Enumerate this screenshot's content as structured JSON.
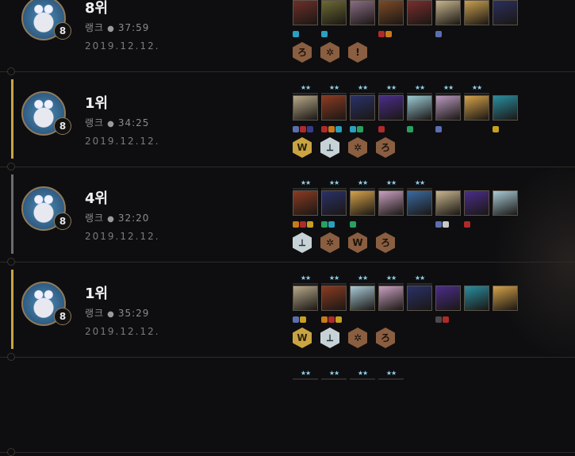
{
  "matches": [
    {
      "placement": "8위",
      "mode": "랭크",
      "duration": "37:59",
      "date": "2019.12.12.",
      "level": "8",
      "accent": "",
      "champions": [
        {
          "stars": "",
          "color": "#6e2f2a",
          "items": [
            "#2aa0c0"
          ]
        },
        {
          "stars": "",
          "color": "#6d6a34",
          "items": [
            "#2aa0c0"
          ]
        },
        {
          "stars": "",
          "color": "#8b6d86",
          "items": []
        },
        {
          "stars": "",
          "color": "#7e4a26",
          "items": [
            "#b02a2a",
            "#c87a1a"
          ]
        },
        {
          "stars": "",
          "color": "#7a2e2e",
          "items": []
        },
        {
          "stars": "",
          "color": "#c7b58e",
          "items": [
            "#5b6fb0"
          ]
        },
        {
          "stars": "",
          "color": "#c9a04e",
          "items": []
        },
        {
          "stars": "",
          "color": "#2b2f5c",
          "items": []
        }
      ],
      "traits": [
        {
          "tier": "bronze",
          "glyph": "ろ",
          "name": "trait-hexagon-icon"
        },
        {
          "tier": "bronze",
          "glyph": "✲",
          "name": "trait-hexagon-icon"
        },
        {
          "tier": "bronze",
          "glyph": "!",
          "name": "trait-hexagon-icon"
        }
      ]
    },
    {
      "placement": "1위",
      "mode": "랭크",
      "duration": "34:25",
      "date": "2019.12.12.",
      "level": "8",
      "accent": "#c9a441",
      "champions": [
        {
          "stars": "★★",
          "color": "#b7a98a",
          "items": [
            "#5b6fb0",
            "#b02a2a",
            "#3a3a8a"
          ]
        },
        {
          "stars": "★★",
          "color": "#8a3b22",
          "items": [
            "#b02a2a",
            "#c87a1a",
            "#2aa0c0"
          ]
        },
        {
          "stars": "★★",
          "color": "#2a3168",
          "items": [
            "#2aa0c0",
            "#28a060"
          ]
        },
        {
          "stars": "★★",
          "color": "#4b2d8a",
          "items": [
            "#b02a2a"
          ]
        },
        {
          "stars": "★★",
          "color": "#9cc9d4",
          "items": [
            "#28a060"
          ]
        },
        {
          "stars": "★★",
          "color": "#b99abf",
          "items": [
            "#5b6fb0"
          ]
        },
        {
          "stars": "★★",
          "color": "#d4a24a",
          "items": []
        },
        {
          "stars": "",
          "color": "#2a8ea0",
          "items": [
            "#c8a020"
          ]
        }
      ],
      "traits": [
        {
          "tier": "gold",
          "glyph": "W",
          "name": "trait-hexagon-icon"
        },
        {
          "tier": "silver",
          "glyph": "⟂",
          "name": "trait-hexagon-icon"
        },
        {
          "tier": "bronze",
          "glyph": "✲",
          "name": "trait-hexagon-icon"
        },
        {
          "tier": "bronze",
          "glyph": "ろ",
          "name": "trait-hexagon-icon"
        }
      ]
    },
    {
      "placement": "4위",
      "mode": "랭크",
      "duration": "32:20",
      "date": "2019.12.12.",
      "level": "8",
      "accent": "#6b6b6b",
      "champions": [
        {
          "stars": "★★",
          "color": "#8a3b22",
          "items": [
            "#c87a1a",
            "#b02a2a",
            "#c8a020"
          ]
        },
        {
          "stars": "★★",
          "color": "#2a3168",
          "items": [
            "#28a060",
            "#2aa0c0"
          ]
        },
        {
          "stars": "★★",
          "color": "#d4a24a",
          "items": [
            "#28a060"
          ]
        },
        {
          "stars": "★★",
          "color": "#c9a0c0",
          "items": []
        },
        {
          "stars": "★★",
          "color": "#3a6aa0",
          "items": []
        },
        {
          "stars": "",
          "color": "#c7b58e",
          "items": [
            "#5b6fb0",
            "#c8c8c8"
          ]
        },
        {
          "stars": "",
          "color": "#4b2d8a",
          "items": [
            "#b02a2a"
          ]
        },
        {
          "stars": "",
          "color": "#a9cad6",
          "items": []
        }
      ],
      "traits": [
        {
          "tier": "silver",
          "glyph": "⟂",
          "name": "trait-hexagon-icon"
        },
        {
          "tier": "bronze",
          "glyph": "✲",
          "name": "trait-hexagon-icon"
        },
        {
          "tier": "bronze",
          "glyph": "W",
          "name": "trait-hexagon-icon"
        },
        {
          "tier": "bronze",
          "glyph": "ろ",
          "name": "trait-hexagon-icon"
        }
      ]
    },
    {
      "placement": "1위",
      "mode": "랭크",
      "duration": "35:29",
      "date": "2019.12.12.",
      "level": "8",
      "accent": "#c9a441",
      "champions": [
        {
          "stars": "★★",
          "color": "#b7a98a",
          "items": [
            "#5b6fb0",
            "#c8a020"
          ]
        },
        {
          "stars": "★★",
          "color": "#8a3b22",
          "items": [
            "#c87a1a",
            "#b02a2a",
            "#c8a020"
          ]
        },
        {
          "stars": "★★",
          "color": "#a9cad6",
          "items": []
        },
        {
          "stars": "★★",
          "color": "#c9a0c0",
          "items": []
        },
        {
          "stars": "★★",
          "color": "#2a3168",
          "items": []
        },
        {
          "stars": "",
          "color": "#4b2d8a",
          "items": [
            "#4a4a4a",
            "#b02a2a"
          ]
        },
        {
          "stars": "",
          "color": "#2a8ea0",
          "items": []
        },
        {
          "stars": "",
          "color": "#d4a24a",
          "items": []
        }
      ],
      "traits": [
        {
          "tier": "gold",
          "glyph": "W",
          "name": "trait-hexagon-icon"
        },
        {
          "tier": "silver",
          "glyph": "⟂",
          "name": "trait-hexagon-icon"
        },
        {
          "tier": "bronze",
          "glyph": "✲",
          "name": "trait-hexagon-icon"
        },
        {
          "tier": "bronze",
          "glyph": "ろ",
          "name": "trait-hexagon-icon"
        }
      ]
    },
    {
      "placement": "",
      "mode": "",
      "duration": "",
      "date": "",
      "level": "",
      "accent": "",
      "champions": [
        {
          "stars": "★★",
          "color": "",
          "items": []
        },
        {
          "stars": "★★",
          "color": "",
          "items": []
        },
        {
          "stars": "★★",
          "color": "",
          "items": []
        },
        {
          "stars": "★★",
          "color": "",
          "items": []
        }
      ],
      "traits": []
    }
  ]
}
